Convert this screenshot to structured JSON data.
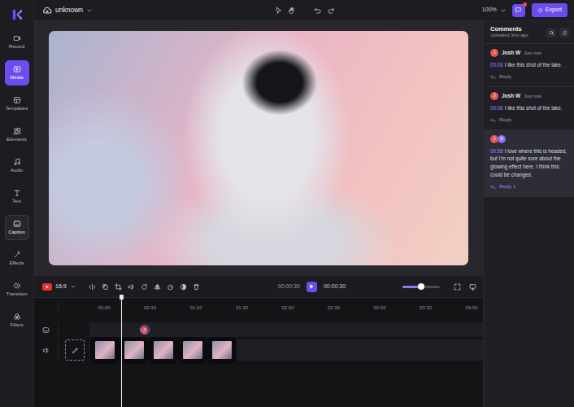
{
  "project": {
    "name": "unknown"
  },
  "sidebar": {
    "items": [
      {
        "label": "Record",
        "selected": false,
        "hovered": false
      },
      {
        "label": "Media",
        "selected": true,
        "hovered": false
      },
      {
        "label": "Templates",
        "selected": false,
        "hovered": false
      },
      {
        "label": "Elements",
        "selected": false,
        "hovered": false
      },
      {
        "label": "Audio",
        "selected": false,
        "hovered": false
      },
      {
        "label": "Text",
        "selected": false,
        "hovered": false
      },
      {
        "label": "Caption",
        "selected": false,
        "hovered": true
      },
      {
        "label": "Effects",
        "selected": false,
        "hovered": false
      },
      {
        "label": "Transition",
        "selected": false,
        "hovered": false
      },
      {
        "label": "Filters",
        "selected": false,
        "hovered": false
      }
    ]
  },
  "topbar": {
    "zoom": "100%",
    "notifications": {
      "unread": true
    },
    "export": "Export"
  },
  "player": {
    "aspect": "16:9",
    "current": "00:00:30",
    "total": "00:00:30",
    "playing": false,
    "zoom_level": 0.5
  },
  "timeline": {
    "ticks": [
      "00:00",
      "00:30",
      "01:00",
      "01:30",
      "02:00",
      "02:30",
      "00:00",
      "03:30",
      "04:00"
    ],
    "playhead_level": 0.073,
    "caption_markers": [
      {
        "initial": "J",
        "color": "#e0574f",
        "level": 0.14
      }
    ],
    "clips": [
      {
        "selected": false
      },
      {
        "selected": false
      },
      {
        "selected": false
      },
      {
        "selected": false
      },
      {
        "selected": false
      }
    ]
  },
  "comments": {
    "title": "Comments",
    "subtitle": "Uploaded 3mo ago",
    "items": [
      {
        "avatars": [
          {
            "initial": "J",
            "color": "#e0574f"
          }
        ],
        "author": "Josh W",
        "time": "Just now",
        "timecode": "00:06",
        "text": "I like this shot of the lake.",
        "reply": "Reply",
        "selected": false
      },
      {
        "avatars": [
          {
            "initial": "J",
            "color": "#e0574f"
          }
        ],
        "author": "Josh W",
        "time": "Just now",
        "timecode": "00:06",
        "text": "I like this shot of the lake.",
        "reply": "Reply",
        "selected": false
      },
      {
        "avatars": [
          {
            "initial": "J",
            "color": "#e0574f"
          },
          {
            "initial": "B",
            "color": "#8b6cf5"
          }
        ],
        "timecode": "00:58",
        "text": "I love where this is headed, but I'm not quite sure about the glowing effect here. I think this could be changed.",
        "reply": "Reply 1",
        "selected": true
      }
    ]
  }
}
